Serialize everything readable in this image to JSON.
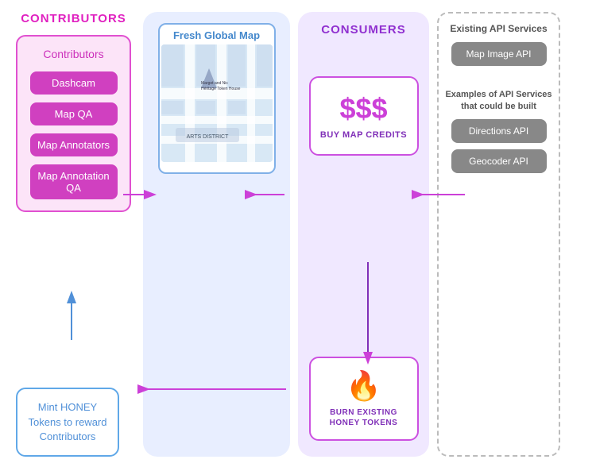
{
  "contributors": {
    "header": "CONTRIBUTORS",
    "box_title": "Contributors",
    "items": [
      "Dashcam",
      "Map QA",
      "Map Annotators",
      "Map Annotation QA"
    ],
    "mint_box": {
      "text": "Mint HONEY Tokens to reward Contributors"
    }
  },
  "center": {
    "map_title": "Fresh Global Map"
  },
  "consumers": {
    "header": "CONSUMERS",
    "buy_credits": {
      "dollar": "$$$",
      "label": "BUY MAP CREDITS"
    },
    "burn": {
      "label": "BURN EXISTING HONEY TOKENS"
    }
  },
  "api": {
    "existing_title": "Existing API Services",
    "map_image_api": "Map Image API",
    "examples_title": "Examples of API Services that could be built",
    "directions_api": "Directions API",
    "geocoder_api": "Geocoder API"
  },
  "colors": {
    "pink": "#e020c0",
    "purple": "#9030d0",
    "blue": "#5090d8",
    "light_blue": "#4488cc",
    "gray": "#888888"
  }
}
